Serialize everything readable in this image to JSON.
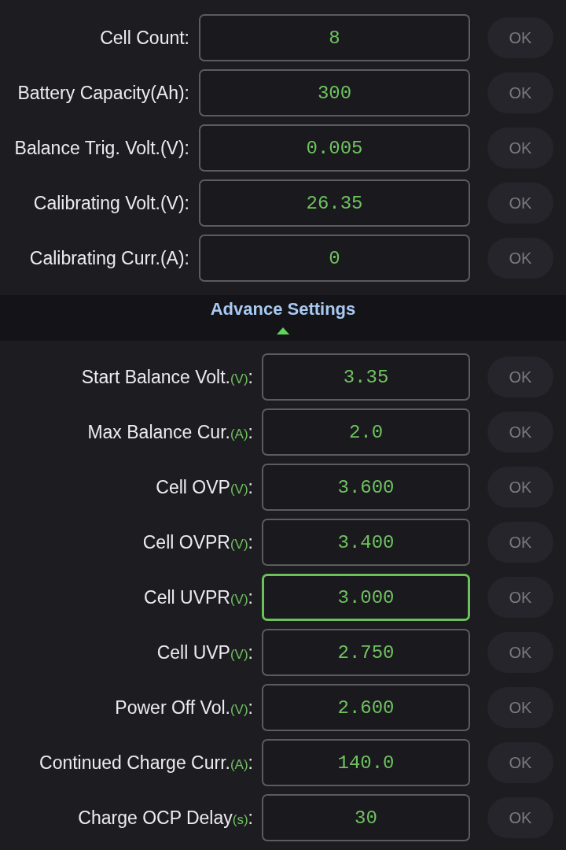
{
  "basic_settings": [
    {
      "label": "Cell Count:",
      "value": "8",
      "focused": false,
      "ok_button": {
        "label": "OK",
        "disabled": true
      }
    },
    {
      "label": "Battery Capacity(Ah):",
      "value": "300",
      "focused": false,
      "ok_button": {
        "label": "OK",
        "disabled": true
      }
    },
    {
      "label": "Balance Trig. Volt.(V):",
      "value": "0.005",
      "focused": false,
      "ok_button": {
        "label": "OK",
        "disabled": true
      }
    },
    {
      "label": "Calibrating Volt.(V):",
      "value": "26.35",
      "focused": false,
      "ok_button": {
        "label": "OK",
        "disabled": true
      }
    },
    {
      "label": "Calibrating Curr.(A):",
      "value": "0",
      "focused": false,
      "ok_button": {
        "label": "OK",
        "disabled": true
      }
    }
  ],
  "advanced_header": {
    "title": "Advance Settings",
    "expanded": true
  },
  "advanced_settings": [
    {
      "label": "Start Balance Volt.",
      "unit": "(V)",
      "label_end": ":",
      "value": "3.35",
      "focused": false,
      "ok_button": {
        "label": "OK",
        "disabled": true
      }
    },
    {
      "label": "Max Balance Cur.",
      "unit": "(A)",
      "label_end": ":",
      "value": "2.0",
      "focused": false,
      "ok_button": {
        "label": "OK",
        "disabled": true
      }
    },
    {
      "label": "Cell OVP",
      "unit": "(V)",
      "label_end": ":",
      "value": "3.600",
      "focused": false,
      "ok_button": {
        "label": "OK",
        "disabled": true
      }
    },
    {
      "label": "Cell OVPR",
      "unit": "(V)",
      "label_end": ":",
      "value": "3.400",
      "focused": false,
      "ok_button": {
        "label": "OK",
        "disabled": true
      }
    },
    {
      "label": "Cell UVPR",
      "unit": "(V)",
      "label_end": ":",
      "value": "3.000",
      "focused": true,
      "ok_button": {
        "label": "OK",
        "disabled": true
      }
    },
    {
      "label": "Cell UVP",
      "unit": "(V)",
      "label_end": ":",
      "value": "2.750",
      "focused": false,
      "ok_button": {
        "label": "OK",
        "disabled": true
      }
    },
    {
      "label": "Power Off Vol.",
      "unit": "(V)",
      "label_end": ":",
      "value": "2.600",
      "focused": false,
      "ok_button": {
        "label": "OK",
        "disabled": true
      }
    },
    {
      "label": "Continued Charge Curr.",
      "unit": "(A)",
      "label_end": ":",
      "value": "140.0",
      "focused": false,
      "ok_button": {
        "label": "OK",
        "disabled": true
      }
    },
    {
      "label": "Charge OCP Delay",
      "unit": "(s)",
      "label_end": ":",
      "value": "30",
      "focused": false,
      "ok_button": {
        "label": "OK",
        "disabled": true
      }
    }
  ]
}
